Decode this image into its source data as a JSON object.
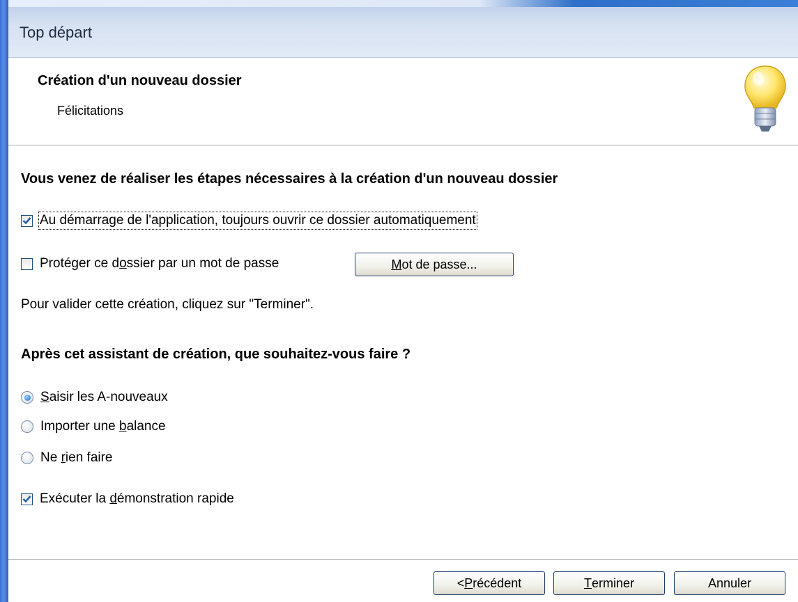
{
  "window": {
    "title": "Top départ"
  },
  "header": {
    "title": "Création d'un nouveau dossier",
    "subtitle": "Félicitations",
    "icon": "lightbulb-icon"
  },
  "section1": {
    "heading": "Vous venez de réaliser les étapes nécessaires à la création d'un nouveau dossier",
    "auto_open": {
      "label": "Au démarrage de l'application, toujours ouvrir ce dossier automatiquement",
      "checked": true
    },
    "protect": {
      "label_before": "Protéger ce d",
      "label_key": "o",
      "label_after": "ssier par un mot de passe",
      "checked": false
    },
    "password_button": {
      "key": "M",
      "rest": "ot de passe..."
    },
    "validate_note": "Pour valider cette création, cliquez sur \"Terminer\"."
  },
  "section2": {
    "heading": "Après cet assistant de création, que souhaitez-vous faire ?",
    "options": [
      {
        "before": "",
        "key": "S",
        "after": "aisir les A-nouveaux",
        "selected": true
      },
      {
        "before": "Importer une ",
        "key": "b",
        "after": "alance",
        "selected": false
      },
      {
        "before": "Ne ",
        "key": "r",
        "after": "ien faire",
        "selected": false
      }
    ],
    "demo": {
      "before": "Exécuter la ",
      "key": "d",
      "after": "émonstration rapide",
      "checked": true
    }
  },
  "footer": {
    "back_button": {
      "before": "< ",
      "key": "P",
      "after": "récédent"
    },
    "finish_button": {
      "before": "",
      "key": "T",
      "after": "erminer"
    },
    "cancel_button": "Annuler"
  },
  "colors": {
    "accent": "#1b6ac4",
    "titlebar": "#d6e1f2",
    "checkmark": "#2a5fa8"
  }
}
